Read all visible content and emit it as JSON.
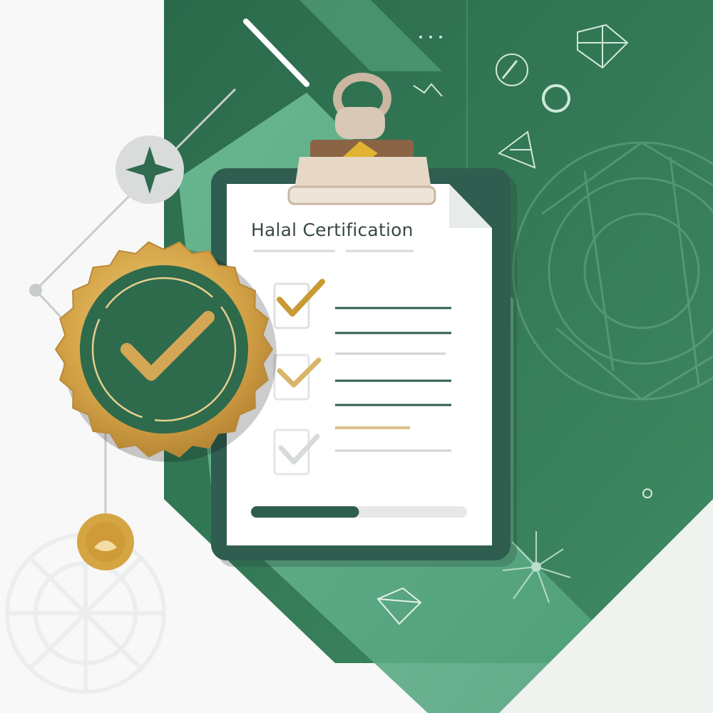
{
  "document": {
    "title": "Halal Certification"
  },
  "checklist": [
    {
      "state": "checked",
      "check_color": "#c99a34",
      "line_colors": [
        "#2f5d4f",
        "#2f5d4f"
      ]
    },
    {
      "state": "checked-faded",
      "check_color": "#d8b56a",
      "line_colors": [
        "#cfd4d1",
        "#2f5d4f",
        "#2f5d4f"
      ]
    },
    {
      "state": "unchecked",
      "check_color": "#d7dbd9",
      "line_colors": [
        "#d9c08a",
        "#cfd4d1"
      ]
    }
  ],
  "progress": {
    "completion": 0.5
  },
  "palette": {
    "dark_green": "#2f6b4e",
    "mid_green": "#4e9e78",
    "light_green": "#7cc3a0",
    "gold": "#c99a34",
    "clipboard_frame": "#2f5d4f",
    "paper": "#ffffff"
  },
  "icons": {
    "badge": "verified-check-badge-icon",
    "star_node": "star-node-icon",
    "gold_node": "gold-coin-node-icon",
    "clip": "binder-clip-icon"
  }
}
